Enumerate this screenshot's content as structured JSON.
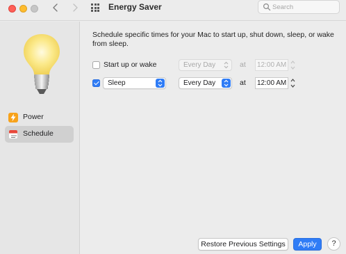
{
  "window": {
    "title": "Energy Saver",
    "search_placeholder": "Search"
  },
  "sidebar": {
    "items": [
      {
        "label": "Power",
        "icon": "lightning-icon"
      },
      {
        "label": "Schedule",
        "icon": "calendar-icon",
        "selected": true
      }
    ]
  },
  "schedule": {
    "description": "Schedule specific times for your Mac to start up, shut down, sleep, or wake from sleep.",
    "startup": {
      "checked": false,
      "label": "Start up or wake",
      "frequency": "Every Day",
      "at": "at",
      "time": "12:00 AM"
    },
    "sleep": {
      "checked": true,
      "action": "Sleep",
      "frequency": "Every Day",
      "at": "at",
      "time": "12:00 AM"
    }
  },
  "footer": {
    "restore_label": "Restore Previous Settings",
    "apply_label": "Apply",
    "help_label": "?"
  },
  "colors": {
    "accent": "#2f7cf6",
    "power_icon": "#f7a21b",
    "schedule_icon": "#e8483b"
  }
}
